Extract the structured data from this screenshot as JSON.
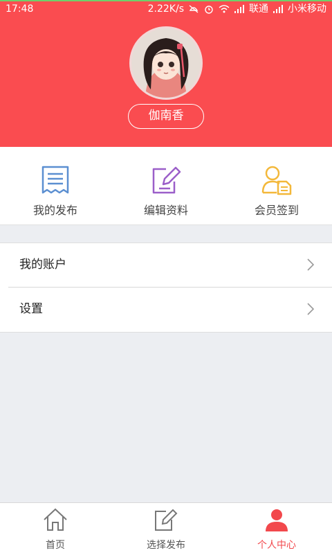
{
  "status_bar": {
    "time": "17:48",
    "speed": "2.22K/s",
    "carrier1": "联通",
    "carrier2": "小米移动"
  },
  "profile": {
    "username": "伽南香",
    "header_color": "#fa4c50"
  },
  "quick_actions": [
    {
      "label": "我的发布",
      "icon": "document-list-icon",
      "color": "#5b8fd1"
    },
    {
      "label": "编辑资料",
      "icon": "edit-pencil-icon",
      "color": "#9b5fc9"
    },
    {
      "label": "会员签到",
      "icon": "member-checkin-icon",
      "color": "#f3b83a"
    }
  ],
  "menu": [
    {
      "label": "我的账户"
    },
    {
      "label": "设置"
    }
  ],
  "tabbar": [
    {
      "label": "首页",
      "icon": "home-icon"
    },
    {
      "label": "选择发布",
      "icon": "publish-icon"
    },
    {
      "label": "个人中心",
      "icon": "user-icon",
      "active": true
    }
  ],
  "accent_color": "#f2484c"
}
